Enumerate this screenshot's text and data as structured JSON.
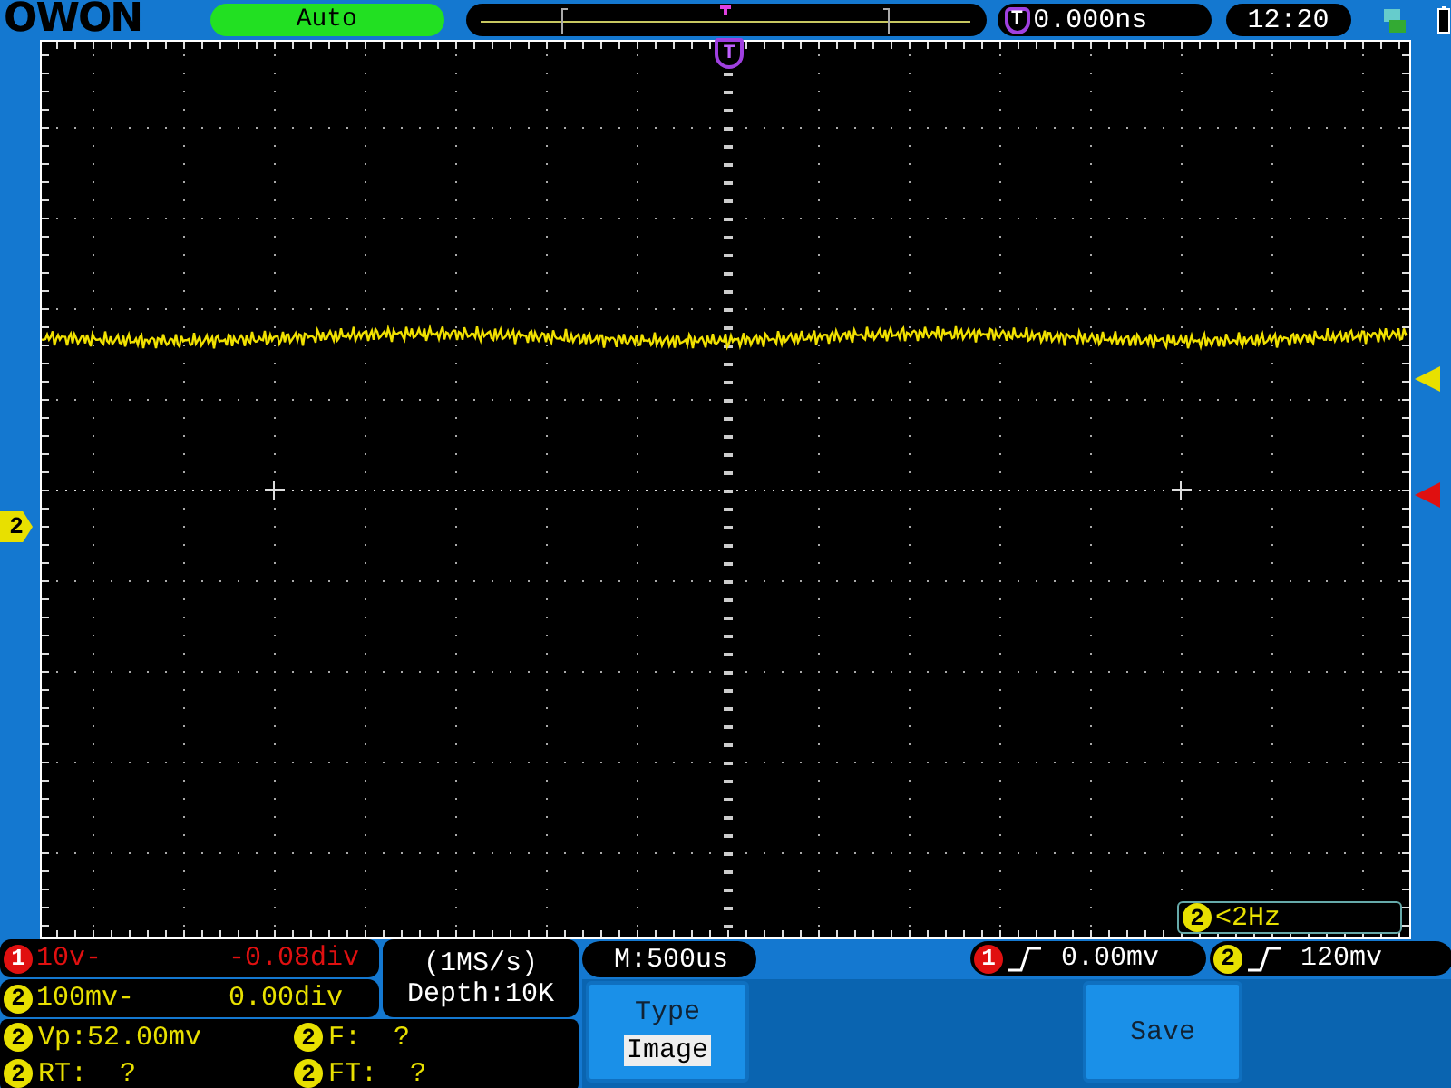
{
  "brand": "OWON",
  "trigger_mode": "Auto",
  "time_offset": {
    "badge": "T",
    "value": "0.000ns"
  },
  "clock": "12:20",
  "trigger_marker": "T",
  "channel_marker": "2",
  "frequency_readout": {
    "badge": "2",
    "value": "<2Hz"
  },
  "channels": [
    {
      "badge": "1",
      "color": "#e01010",
      "scale": "10v-",
      "offset": "-0.08div"
    },
    {
      "badge": "2",
      "color": "#e8e000",
      "scale": "100mv-",
      "offset": "0.00div"
    }
  ],
  "sample_rate": "(1MS/s)",
  "depth": "Depth:10K",
  "timebase": "M:500us",
  "triggers": [
    {
      "badge": "1",
      "color": "#e01010",
      "level": "0.00mv"
    },
    {
      "badge": "2",
      "color": "#e8e000",
      "level": "120mv"
    }
  ],
  "measurements": [
    {
      "badge": "2",
      "text": "Vp:52.00mv"
    },
    {
      "badge": "2",
      "text": "F:  ?"
    },
    {
      "badge": "2",
      "text": "RT:  ?"
    },
    {
      "badge": "2",
      "text": "FT:  ?"
    }
  ],
  "menu": [
    {
      "kind": "select",
      "label": "Type",
      "value": "Image"
    },
    {
      "kind": "action",
      "label": "Save"
    }
  ]
}
